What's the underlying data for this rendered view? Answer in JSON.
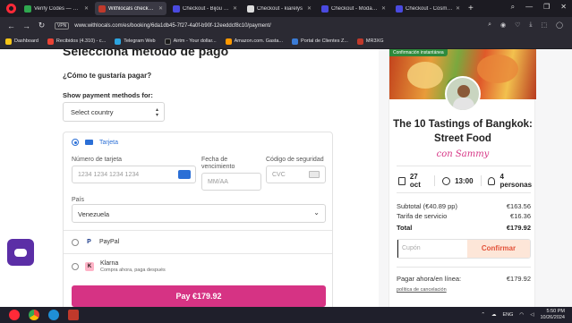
{
  "browser": {
    "tabs": [
      {
        "label": "Verify Codes — SimplyCodes",
        "fav_color": "#2fa84f",
        "active": false
      },
      {
        "label": "Withlocals checkout - Thai",
        "fav_color": "#c0392b",
        "active": true
      },
      {
        "label": "Checkout - Bijou Build",
        "fav_color": "#4a4ae0",
        "active": false
      },
      {
        "label": "Checkout - kiarelys",
        "fav_color": "#dddddd",
        "active": false
      },
      {
        "label": "Checkout - ModaConcrete",
        "fav_color": "#4a4ae0",
        "active": false
      },
      {
        "label": "Checkout - CosmoxToys",
        "fav_color": "#4a4ae0",
        "active": false
      }
    ],
    "url": "www.withlocals.com/es/booking/6da1db45-7f27-4a0f-b90f-12eeddcf8c10/payment/",
    "vpn_label": "VPN",
    "bookmarks": [
      {
        "label": "Dashboard",
        "color": "#f5c518"
      },
      {
        "label": "Recibidos (4.310) - c...",
        "color": "#ea4335"
      },
      {
        "label": "Telegram Web",
        "color": "#2ca5e0"
      },
      {
        "label": "Airtm - Your dollar...",
        "color": "#1b1b1b"
      },
      {
        "label": "Amazon.com. Gasta...",
        "color": "#ff9900"
      },
      {
        "label": "Portal de Clientes Z...",
        "color": "#3a7bd5"
      },
      {
        "label": "MR3XG",
        "color": "#c0392b"
      }
    ]
  },
  "payment": {
    "heading": "Selecciona método de pago",
    "question": "¿Cómo te gustaría pagar?",
    "show_methods_label": "Show payment methods for:",
    "country_select": "Select country",
    "card_method_label": "Tarjeta",
    "card_number_label": "Número de tarjeta",
    "card_number_placeholder": "1234 1234 1234 1234",
    "expiry_label": "Fecha de vencimiento",
    "expiry_placeholder": "MM/AA",
    "cvc_label": "Código de seguridad",
    "cvc_placeholder": "CVC",
    "country_label": "País",
    "country_value": "Venezuela",
    "paypal_label": "PayPal",
    "klarna_label": "Klarna",
    "klarna_sub": "Compra ahora, paga después",
    "pay_button": "Pay €179.92"
  },
  "summary": {
    "badge": "Confirmación instantánea",
    "title": "The 10 Tastings of Bangkok: Street Food",
    "host": "con Sammy",
    "date": "27 oct",
    "time": "13:00",
    "people": "4 personas",
    "subtotal_label": "Subtotal (€40.89 pp)",
    "subtotal_value": "€163.56",
    "fee_label": "Tarifa de servicio",
    "fee_value": "€16.36",
    "total_label": "Total",
    "total_value": "€179.92",
    "coupon_placeholder": "Cupón",
    "coupon_button": "Confirmar",
    "pay_now_label": "Pagar ahora/en línea:",
    "pay_now_value": "€179.92",
    "cancel_policy": "política de cancelación"
  },
  "taskbar": {
    "lang": "ENG",
    "time": "5:50 PM",
    "date": "10/26/2024"
  },
  "colors": {
    "accent_pink": "#d63384",
    "link_blue": "#2b6fd6",
    "coupon_orange": "#e3533a",
    "chat_purple": "#5b2ea6"
  }
}
